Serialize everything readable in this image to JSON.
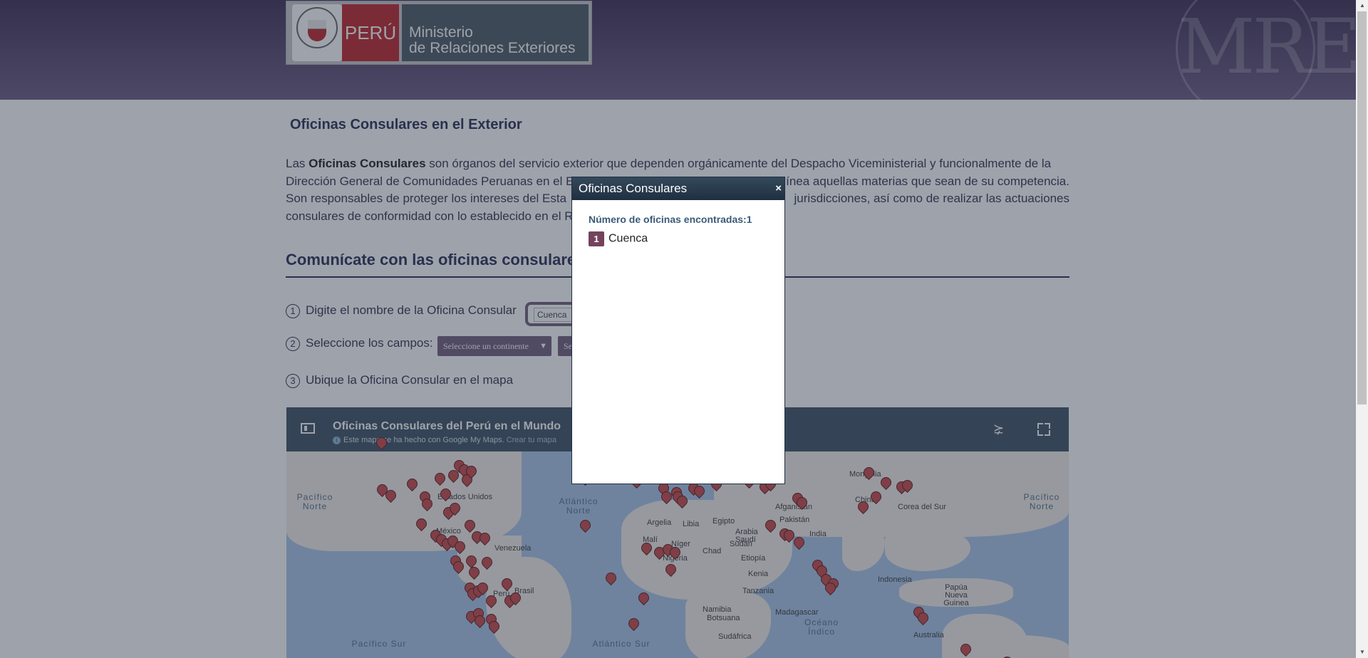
{
  "header": {
    "logo_country": "PERÚ",
    "logo_ministry_line1": "Ministerio",
    "logo_ministry_line2": "de Relaciones Exteriores",
    "watermark": "MRE"
  },
  "page": {
    "title": "Oficinas Consulares en el Exterior",
    "intro_prefix": "Las ",
    "intro_bold": "Oficinas Consulares",
    "intro_line1_rest": " son órganos del servicio exterior que dependen orgánicamente del Despacho Viceministerial y funcionalmente de la",
    "intro_line2": "Dirección General de Comunidades Peruanas en el E",
    "intro_line2_right": "ínea aquellas materias que sean de su competencia.",
    "intro_line3": "Son responsables de proteger los intereses del Esta",
    "intro_line3_right": "jurisdicciones, así como de realizar las actuaciones",
    "intro_line4": "consulares de conformidad con lo establecido en el R",
    "section_title": "Comunícate con las oficinas consulare"
  },
  "steps": {
    "step1_num": "1",
    "step1_label": "Digite el nombre de la Oficina Consular",
    "search_value": "Cuenca",
    "step2_num": "2",
    "step2_label": "Seleccione los campos:",
    "continent_select": "Seleccione un continente",
    "country_select": "Se",
    "step3_num": "3",
    "step3_label": "Ubique la Oficina Consular en el mapa"
  },
  "map": {
    "title": "Oficinas Consulares del Perú en el Mundo",
    "subtitle_main": "Este mapa se ha hecho con Google My Maps.",
    "subtitle_link": "Crear tu mapa",
    "labels": [
      "Mongolia",
      "China",
      "Afganistán",
      "Pakistán",
      "India",
      "Argelia",
      "Libia",
      "Egipto",
      "Arabia Saudí",
      "Malí",
      "Níger",
      "Chad",
      "Sudán",
      "Nigeria",
      "Etiopía",
      "Kenia",
      "Tanzania",
      "Namibia",
      "Botsuana",
      "Madagascar",
      "Sudáfrica",
      "Brasil",
      "Perú",
      "México",
      "Venezuela",
      "Estados Unidos",
      "Indonesia",
      "Papúa Nueva Guinea",
      "Australia",
      "Corea del Sur"
    ],
    "oceans": [
      "Pacífico Norte",
      "Atlántico Norte",
      "Pacífico Norte",
      "Pacífico Sur",
      "Atlántico Sur",
      "Océano Índico"
    ]
  },
  "modal": {
    "title": "Oficinas Consulares",
    "close": "×",
    "count_label": "Número de oficinas encontradas:1",
    "results": [
      {
        "index": "1",
        "name": "Cuenca"
      }
    ]
  },
  "colors": {
    "header_bg": "#3f3156",
    "accent_purple": "#73607e",
    "badge": "#73435d",
    "modal_header": "#1f2f40",
    "map_bar": "#3f5566",
    "pin": "#c94a4a"
  }
}
